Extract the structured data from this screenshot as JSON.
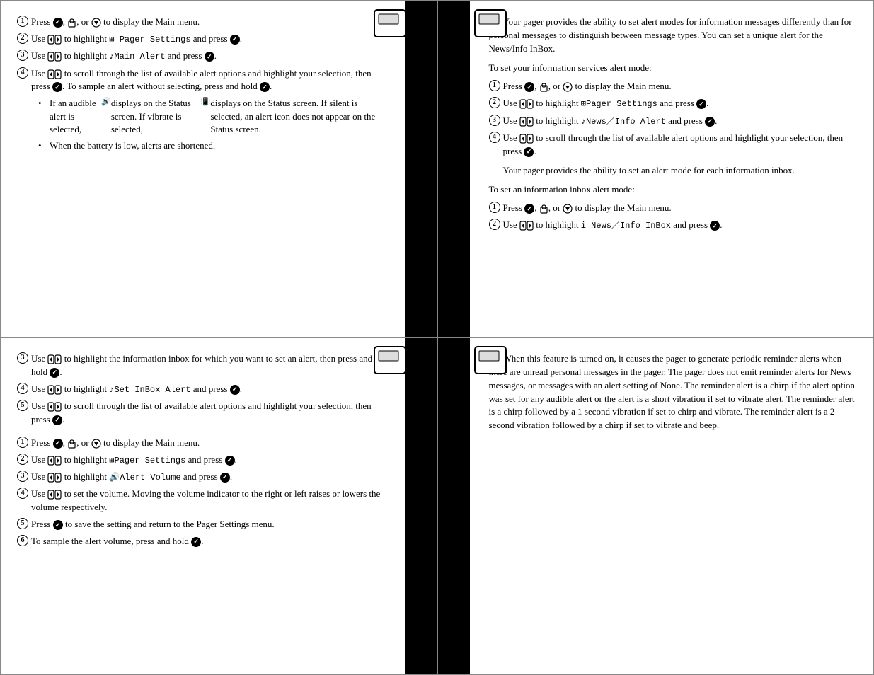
{
  "panels": {
    "top_left": {
      "steps": [
        {
          "num": "❶",
          "text_parts": [
            "Press ",
            "✓",
            ", ",
            "🔒",
            ", or ",
            "⬇",
            " to display the Main menu."
          ]
        },
        {
          "num": "❷",
          "text_parts": [
            "Use ",
            "scroll",
            " to highlight ",
            "mono:⊞ Pager Settings",
            " and press ",
            "✓",
            "."
          ]
        },
        {
          "num": "❸",
          "text_parts": [
            "Use ",
            "scroll",
            " to highlight ",
            "mono:♪Main Alert",
            " and press ",
            "✓",
            "."
          ]
        },
        {
          "num": "❹",
          "text_parts": [
            "Use ",
            "scroll",
            " to scroll through the list of available alert options and highlight your selection, then press ",
            "✓",
            ". To sample an alert without selecting, press and hold ",
            "✓",
            "."
          ]
        }
      ],
      "bullets": [
        "If an audible alert is selected, 🔊 displays on the Status screen. If vibrate is selected, 📳 displays on the Status screen. If silent is selected, an alert icon does not appear on the Status screen.",
        "When the battery is low, alerts are shortened."
      ]
    },
    "top_right": {
      "intro": "Your pager provides the ability to set alert modes for information messages differently than for personal messages to distinguish between message types. You can set a unique alert for the News/Info InBox.",
      "section1_title": "To set your information services alert mode:",
      "steps1": [
        {
          "num": "❶",
          "text": "Press ✓, 🔒, or ⬇ to display the Main menu."
        },
        {
          "num": "❷",
          "text": "Use scroll to highlight ⊞Pager Settings and press ✓."
        },
        {
          "num": "❸",
          "text": "Use scroll to highlight ♪News／Info Alert and press ✓."
        },
        {
          "num": "❹",
          "text": "Use scroll to scroll through the list of available alert options and highlight your selection, then press ✓."
        }
      ],
      "section2_intro": "Your pager provides the ability to set an alert mode for each information inbox.",
      "section2_title": "To set an information inbox alert mode:",
      "steps2": [
        {
          "num": "❶",
          "text": "Press ✓, 🔒, or ⬇ to display the Main menu."
        },
        {
          "num": "❷",
          "text": "Use scroll to highlight i News／Info InBox and press ✓."
        }
      ]
    },
    "bottom_left": {
      "steps_continued": [
        {
          "num": "❸",
          "text": "Use scroll to highlight the information inbox for which you want to set an alert, then press and hold ✓."
        },
        {
          "num": "❹",
          "text": "Use scroll to highlight ♪Set InBox Alert and press ✓."
        },
        {
          "num": "❺",
          "text": "Use scroll to scroll through the list of available alert options and highlight your selection, then press ✓."
        }
      ],
      "steps2": [
        {
          "num": "❶",
          "text": "Press ✓, 🔒, or ⬇ to display the Main menu."
        },
        {
          "num": "❷",
          "text": "Use scroll to highlight ⊞Pager Settings and press ✓."
        },
        {
          "num": "❸",
          "text": "Use scroll to highlight 🔊Alert Volume and press ✓."
        },
        {
          "num": "❹",
          "text": "Use scroll to set the volume. Moving the volume indicator to the right or left raises or lowers the volume respectively."
        },
        {
          "num": "❺",
          "text": "Press ✓ to save the setting and return to the Pager Settings menu."
        },
        {
          "num": "❻",
          "text": "To sample the alert volume, press and hold ✓."
        }
      ]
    },
    "bottom_right": {
      "text": "When this feature is turned on, it causes the pager to generate periodic reminder alerts when there are unread personal messages in the pager. The pager does not emit reminder alerts for News messages, or messages with an alert setting of None. The reminder alert is a chirp if the alert option was set for any audible alert or the alert is a short vibration if set to vibrate alert. The reminder alert is a chirp followed by a 1 second vibration if set to chirp and vibrate. The reminder alert is a 2 second vibration followed by a chirp if set to vibrate and beep."
    }
  }
}
